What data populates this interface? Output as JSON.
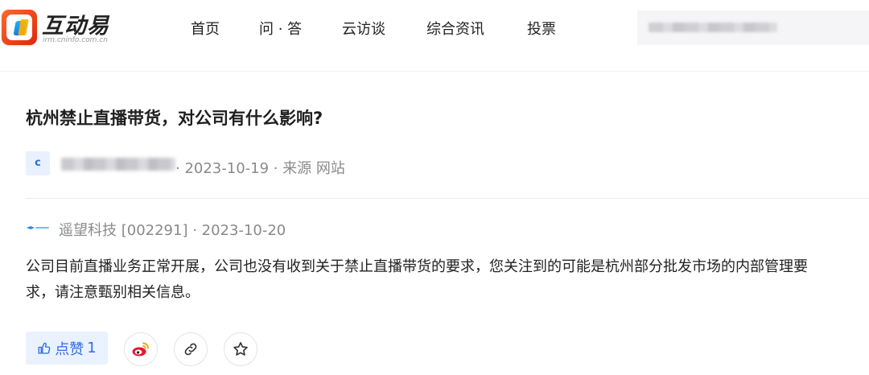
{
  "header": {
    "brand": "互动易",
    "brand_sub": "irm.cninfo.com.cn",
    "nav": [
      "首页",
      "问 · 答",
      "云访谈",
      "综合资讯",
      "投票"
    ]
  },
  "question": {
    "title": "杭州禁止直播带货，对公司有什么影响?",
    "avatar_letter": "c",
    "meta": "· 2023-10-19 · 来源 网站"
  },
  "answer": {
    "company": "遥望科技 [002291] · 2023-10-20",
    "text_line1": "公司目前直播业务正常开展，公司也没有收到关于禁止直播带货的要求，您关注到的可能是杭州部分批发市场的内部管理要",
    "text_line2": "求，请注意甄别相关信息。"
  },
  "actions": {
    "like_label": "点赞",
    "like_count": "1"
  },
  "colors": {
    "accent": "#2e6be6",
    "meta": "#8a8a8a",
    "weibo": "#e6162d"
  }
}
